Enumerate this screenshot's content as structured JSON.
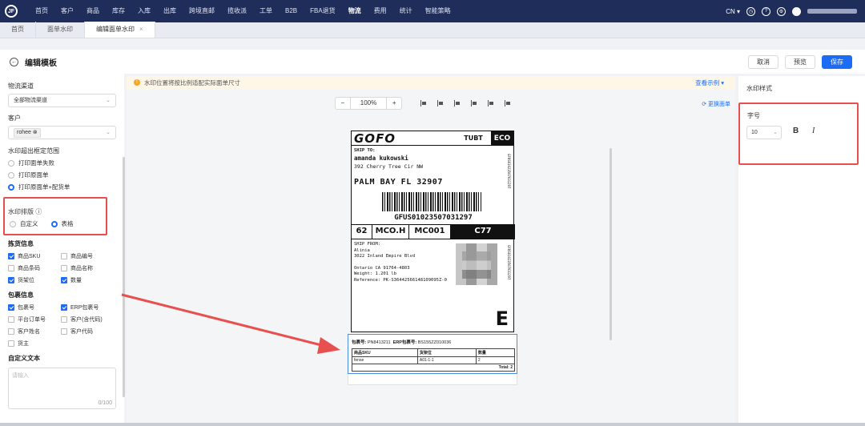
{
  "nav": {
    "logo": "JF",
    "items": [
      "首页",
      "客户",
      "商品",
      "库存",
      "入库",
      "出库",
      "跨境直邮",
      "揽收派",
      "工单",
      "B2B",
      "FBA退货",
      "物流",
      "费用",
      "统计",
      "智能策略"
    ],
    "active_index": 11,
    "lang": "CN ▾"
  },
  "tabs": [
    {
      "label": "首页"
    },
    {
      "label": "面单水印"
    },
    {
      "label": "编辑面单水印",
      "close": "×"
    }
  ],
  "header": {
    "title": "编辑模板",
    "cancel_label": "取消",
    "preview_label": "预览",
    "save_label": "保存"
  },
  "left": {
    "channel_label": "物流渠道",
    "channel_value": "全部物流渠道",
    "customer_label": "客户",
    "customer_tag": "rohee",
    "overflow_label": "水印超出框定范围",
    "overflow_options": [
      "打印面单失败",
      "打印原面单",
      "打印原面单+配货单"
    ],
    "overflow_selected": 2,
    "layout_label": "水印排版",
    "layout_options": [
      "自定义",
      "表格"
    ],
    "layout_selected": 1,
    "pick_section": "拣货信息",
    "pick_items": [
      {
        "label": "商品SKU",
        "checked": true
      },
      {
        "label": "商品编号",
        "checked": false
      },
      {
        "label": "商品条码",
        "checked": false
      },
      {
        "label": "商品名称",
        "checked": false
      },
      {
        "label": "货架位",
        "checked": true
      },
      {
        "label": "数量",
        "checked": true
      }
    ],
    "pkg_section": "包裹信息",
    "pkg_items": [
      {
        "label": "包裹号",
        "checked": true
      },
      {
        "label": "ERP包裹号",
        "checked": true
      },
      {
        "label": "平台订单号",
        "checked": false
      },
      {
        "label": "客户(含代码)",
        "checked": false
      },
      {
        "label": "客户姓名",
        "checked": false
      },
      {
        "label": "客户代码",
        "checked": false
      },
      {
        "label": "货主",
        "checked": false
      }
    ],
    "custom_section": "自定义文本",
    "custom_placeholder": "请输入",
    "custom_count": "0/100"
  },
  "center": {
    "notice": "水印位置将按比例适配实际面单尺寸",
    "notice_link": "查看示例 ▾",
    "zoom_minus": "−",
    "zoom_value": "100%",
    "zoom_plus": "+",
    "replace_label": "⟳ 更换面单"
  },
  "shipping_label": {
    "brand": "GOFO",
    "service": "TUBT",
    "tier": "ECO",
    "ship_to_title": "SHIP TO:",
    "recipient": "amanda kukowski",
    "address": "392 Cherry Tree Cir NW",
    "city_line": "PALM BAY FL  32907",
    "tracking": "GFUS01023507031297",
    "code1": "62",
    "code2": "MCO.H",
    "code3": "MC001",
    "code4": "C77",
    "from_title": "SHIP FROM:",
    "from_name": "Alinia",
    "from_addr": "3022 Inland Empire Blvd",
    "from_city": "Ontario CA 91764-4803",
    "weight": "Weight: 1.201 lb",
    "reference": "Reference: PK-S36442566148109095Z-0",
    "side_code1": "GFUS01023507031297",
    "side_code2": "GFUS01023507031297",
    "big_letter": "E"
  },
  "watermark": {
    "pkg_label": "包裹号:",
    "pkg_value": "PN8413211",
    "erp_label": "ERP包裹号:",
    "erp_value": "BS155ZZ010036",
    "headers": [
      "商品SKU",
      "货架位",
      "数量"
    ],
    "row": [
      "fense",
      "A01-1-1",
      "2"
    ],
    "total": "Total: 2"
  },
  "right": {
    "title": "水印样式",
    "font_size_label": "字号",
    "font_size_value": "10",
    "bold": "B",
    "italic": "I"
  },
  "colors": {
    "nav_bg": "#1f2d5a",
    "primary": "#1c6cf5",
    "highlight": "#e85050"
  }
}
